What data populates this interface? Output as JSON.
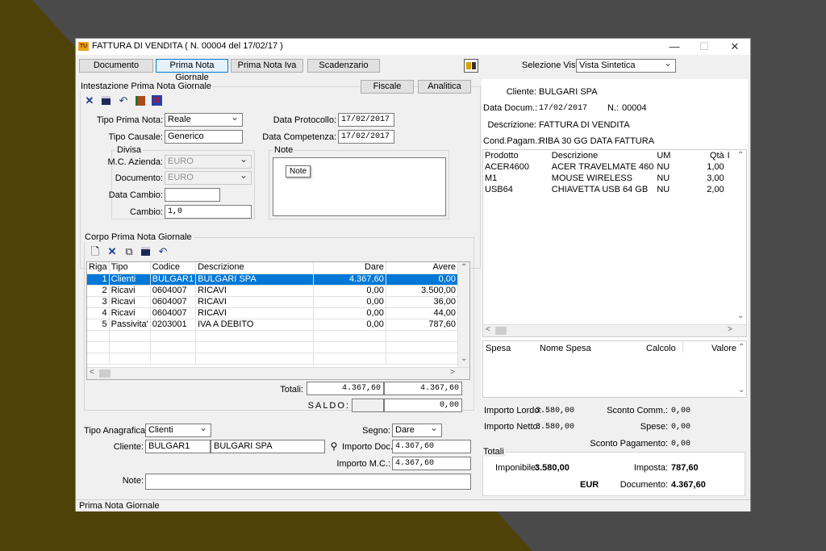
{
  "window": {
    "title": "FATTURA DI VENDITA ( N. 00004 del 17/02/17 )",
    "app_icon_text": "TU"
  },
  "tabs": [
    {
      "label": "Documento"
    },
    {
      "label": "Prima Nota Giornale"
    },
    {
      "label": "Prima Nota Iva"
    },
    {
      "label": "Scadenzario"
    }
  ],
  "view": {
    "label": "Selezione Vista:",
    "value": "Vista Sintetica"
  },
  "header_group": {
    "title": "Intestazione Prima Nota Giornale",
    "fiscale_label": "Fiscale",
    "analitica_label": "Analitica",
    "tipo_prima_nota_label": "Tipo Prima Nota:",
    "tipo_prima_nota_value": "Reale",
    "tipo_causale_label": "Tipo Causale:",
    "tipo_causale_value": "Generico",
    "data_protocollo_label": "Data Protocollo:",
    "data_protocollo_value": "17/02/2017",
    "data_competenza_label": "Data Competenza:",
    "data_competenza_value": "17/02/2017"
  },
  "divisa": {
    "title": "Divisa",
    "mc_azienda_label": "M.C. Azienda:",
    "mc_azienda_value": "EURO",
    "documento_label": "Documento:",
    "documento_value": "EURO",
    "data_cambio_label": "Data Cambio:",
    "data_cambio_value": "",
    "cambio_label": "Cambio:",
    "cambio_value": "1,0"
  },
  "note_group": {
    "title": "Note",
    "tooltip": "Note"
  },
  "corpo": {
    "title": "Corpo Prima Nota Giornale",
    "columns": [
      "Riga",
      "Tipo",
      "Codice",
      "Descrizione",
      "Dare",
      "Avere"
    ],
    "rows": [
      {
        "riga": "1",
        "tipo": "Clienti",
        "codice": "BULGAR1",
        "descrizione": "BULGARI SPA",
        "dare": "4.367,60",
        "avere": "0,00"
      },
      {
        "riga": "2",
        "tipo": "Ricavi",
        "codice": "0604007",
        "descrizione": "RICAVI",
        "dare": "0,00",
        "avere": "3.500,00"
      },
      {
        "riga": "3",
        "tipo": "Ricavi",
        "codice": "0604007",
        "descrizione": "RICAVI",
        "dare": "0,00",
        "avere": "36,00"
      },
      {
        "riga": "4",
        "tipo": "Ricavi",
        "codice": "0604007",
        "descrizione": "RICAVI",
        "dare": "0,00",
        "avere": "44,00"
      },
      {
        "riga": "5",
        "tipo": "Passivita'",
        "codice": "0203001",
        "descrizione": "IVA A DEBITO",
        "dare": "0,00",
        "avere": "787,60"
      }
    ],
    "totali_label": "Totali:",
    "totale_dare": "4.367,60",
    "totale_avere": "4.367,60",
    "saldo_label": "SALDO:",
    "saldo_value": "0,00"
  },
  "bottom": {
    "tipo_anagrafica_label": "Tipo Anagrafica:",
    "tipo_anagrafica_value": "Clienti",
    "segno_label": "Segno:",
    "segno_value": "Dare",
    "cliente_label": "Cliente:",
    "cliente_code": "BULGAR1",
    "cliente_name": "BULGARI SPA",
    "importo_doc_label": "Importo Doc.:",
    "importo_doc_value": "4.367,60",
    "importo_mc_label": "Importo M.C.:",
    "importo_mc_value": "4.367,60",
    "note_label": "Note:",
    "note_value": ""
  },
  "right": {
    "cliente_label": "Cliente:",
    "cliente_value": "BULGARI SPA",
    "data_docum_label": "Data Docum.:",
    "data_docum_value": "17/02/2017",
    "n_label": "N.:",
    "n_value": "00004",
    "descrizione_label": "Descrizione:",
    "descrizione_value": "FATTURA DI VENDITA",
    "cond_pagam_label": "Cond.Pagam.:",
    "cond_pagam_value": "RIBA 30 GG DATA FATTURA",
    "prod_columns": [
      "Prodotto",
      "Descrizione",
      "UM",
      "Qtà",
      "I"
    ],
    "products": [
      {
        "prodotto": "ACER4600",
        "descrizione": "ACER TRAVELMATE 460",
        "um": "NU",
        "qta": "1,00"
      },
      {
        "prodotto": "M1",
        "descrizione": "MOUSE WIRELESS",
        "um": "NU",
        "qta": "3,00"
      },
      {
        "prodotto": "USB64",
        "descrizione": "CHIAVETTA USB 64 GB",
        "um": "NU",
        "qta": "2,00"
      }
    ],
    "spese_columns": [
      "Spesa",
      "Nome Spesa",
      "Calcolo",
      "Valore"
    ],
    "importo_lordo_label": "Importo Lordo:",
    "importo_lordo_value": "3.580,00",
    "sconto_comm_label": "Sconto Comm.:",
    "sconto_comm_value": "0,00",
    "importo_netto_label": "Importo Netto:",
    "importo_netto_value": "3.580,00",
    "spese_label": "Spese:",
    "spese_value": "0,00",
    "sconto_pagamento_label": "Sconto Pagamento:",
    "sconto_pagamento_value": "0,00",
    "totali_title": "Totali",
    "imponibile_label": "Imponibile:",
    "imponibile_value": "3.580,00",
    "imposta_label": "Imposta:",
    "imposta_value": "787,60",
    "currency": "EUR",
    "documento_label": "Documento:",
    "documento_value": "4.367,60"
  },
  "status": {
    "text": "Prima Nota Giornale"
  }
}
